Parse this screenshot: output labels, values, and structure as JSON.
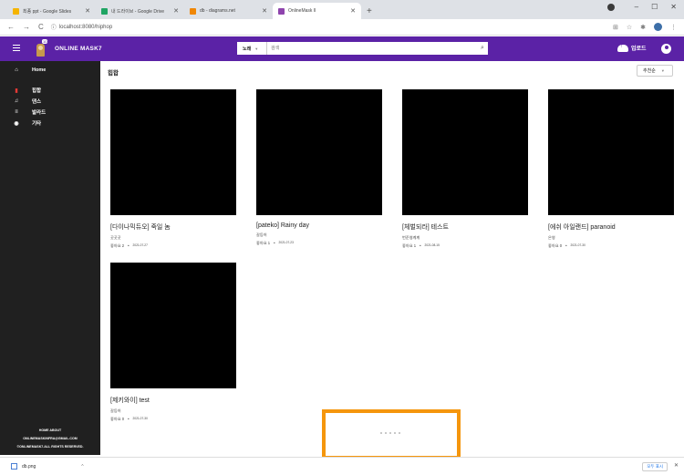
{
  "browser": {
    "tabs": [
      {
        "title": "최종 ppt - Google Slides",
        "color": "#f5b400",
        "active": false
      },
      {
        "title": "내 드라이브 - Google Drive",
        "color": "#1fa463",
        "active": false
      },
      {
        "title": "db - diagrams.net",
        "color": "#f08705",
        "active": false
      },
      {
        "title": "OnlineMask II",
        "color": "#8e44ad",
        "active": true
      }
    ],
    "new_tab": "+",
    "address": "localhost:8080/hiphop",
    "download": {
      "file": "db.png",
      "show_all": "모두 표시"
    }
  },
  "app": {
    "brand": "ONLINE MASK7",
    "logo_badge": "10",
    "search_category": "노래",
    "search_placeholder": "검색",
    "upload_label": "업로드",
    "accent": "#5b22a6"
  },
  "sidebar": {
    "home": "Home",
    "items": [
      {
        "icon": "microphone-icon",
        "glyph": "🎤",
        "label": "힙합",
        "color": "#e53935"
      },
      {
        "icon": "music-note-icon",
        "glyph": "♫",
        "label": "댄스",
        "color": "#ffffff"
      },
      {
        "icon": "playlist-icon",
        "glyph": "≡",
        "label": "발라드",
        "color": "#ffffff"
      },
      {
        "icon": "compass-icon",
        "glyph": "◉",
        "label": "기타",
        "color": "#ffffff"
      }
    ],
    "footer": [
      "HOME      ABOUT",
      "ONLINEMASKINFRA@GMAIL.COM",
      "©ONLINEMASK7.ALL RIGHTS RESERVED."
    ]
  },
  "main": {
    "page_title": "힙합",
    "sort_label": "추천순",
    "cards": [
      {
        "title": "[다이나믹듀오] 죽일 놈",
        "author": "곳곳곳",
        "likes": "좋아요 2",
        "date": "2021-07-27"
      },
      {
        "title": "[pateko] Rainy day",
        "author": "갈등허",
        "likes": "좋아요 1",
        "date": "2021-07-23"
      },
      {
        "title": "[체벌되라] 테스트",
        "author": "번준영계계",
        "likes": "좋아요 1",
        "date": "2021-08-15"
      },
      {
        "title": "[에쉬 아일랜드] paranoid",
        "author": "은영",
        "likes": "좋아요 0",
        "date": "2021-07-30"
      },
      {
        "title": "[제키와이] test",
        "author": "갈등허",
        "likes": "좋아요 0",
        "date": "2021-07-30"
      }
    ]
  }
}
